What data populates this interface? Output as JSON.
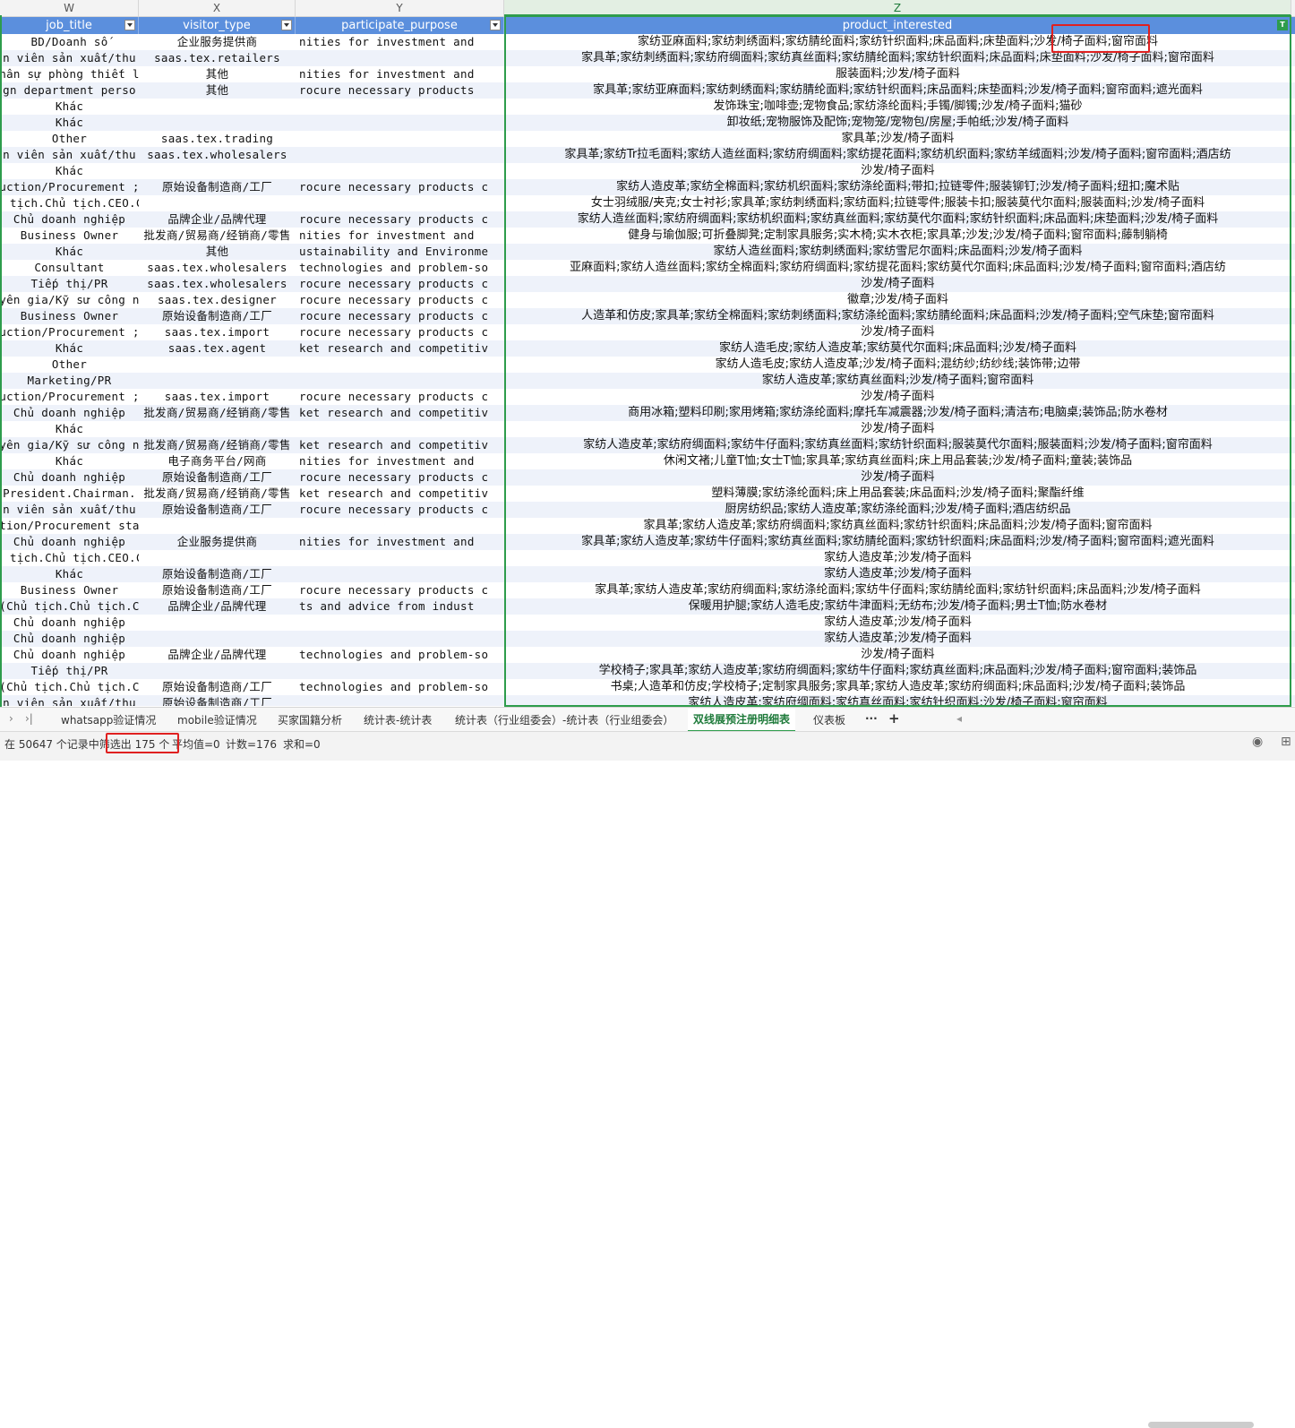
{
  "columns": [
    {
      "letter": "W",
      "field": "job_title"
    },
    {
      "letter": "X",
      "field": "visitor_type"
    },
    {
      "letter": "Y",
      "field": "participate_purpose"
    },
    {
      "letter": "Z",
      "field": "product_interested"
    }
  ],
  "rows": [
    [
      "BD/Doanh số",
      "企业服务提供商",
      "nities for investment and",
      "家纺亚麻面料;家纺刺绣面料;家纺腈纶面料;家纺针织面料;床品面料;床垫面料;沙发/椅子面料;窗帘面料"
    ],
    [
      "n viên sản xuất/thu",
      "saas.tex.retailers",
      "",
      "家具革;家纺刺绣面料;家纺府绸面料;家纺真丝面料;家纺腈纶面料;家纺针织面料;床品面料;床垫面料;沙发/椅子面料;窗帘面料"
    ],
    [
      "hân sự phòng thiết l",
      "其他",
      "nities for investment and",
      "服装面料;沙发/椅子面料"
    ],
    [
      "gn department perso",
      "其他",
      "rocure necessary products",
      "家具革;家纺亚麻面料;家纺刺绣面料;家纺腈纶面料;家纺针织面料;床品面料;床垫面料;沙发/椅子面料;窗帘面料;遮光面料"
    ],
    [
      "Khác",
      "",
      "",
      "发饰珠宝;咖啡壶;宠物食品;家纺涤纶面料;手镯/脚镯;沙发/椅子面料;猫砂"
    ],
    [
      "Khác",
      "",
      "",
      "卸妆纸;宠物服饰及配饰;宠物笼/宠物包/房屋;手帕纸;沙发/椅子面料"
    ],
    [
      "Other",
      "saas.tex.trading",
      "",
      "家具革;沙发/椅子面料"
    ],
    [
      "n viên sản xuất/thu",
      "saas.tex.wholesalers",
      "",
      "家具革;家纺Tr拉毛面料;家纺人造丝面料;家纺府绸面料;家纺提花面料;家纺机织面料;家纺羊绒面料;沙发/椅子面料;窗帘面料;酒店纺"
    ],
    [
      "Khác",
      "",
      "",
      "沙发/椅子面料"
    ],
    [
      "uction/Procurement ;",
      "原始设备制造商/工厂",
      "rocure necessary products c",
      "家纺人造皮革;家纺全棉面料;家纺机织面料;家纺涤纶面料;带扣;拉链零件;服装铆钉;沙发/椅子面料;纽扣;魔术贴"
    ],
    [
      "(Chủ tịch.Chủ tịch.CEO.COO)",
      "",
      "",
      "女士羽绒服/夹克;女士衬衫;家具革;家纺刺绣面料;家纺面料;拉链零件;服装卡扣;服装莫代尔面料;服装面料;沙发/椅子面料"
    ],
    [
      "Chủ doanh nghiệp",
      "品牌企业/品牌代理",
      "rocure necessary products c",
      "家纺人造丝面料;家纺府绸面料;家纺机织面料;家纺真丝面料;家纺莫代尔面料;家纺针织面料;床品面料;床垫面料;沙发/椅子面料"
    ],
    [
      "Business Owner",
      "批发商/贸易商/经销商/零售",
      "nities for investment and",
      "健身与瑜伽服;可折叠脚凳;定制家具服务;实木椅;实木衣柜;家具革;沙发;沙发/椅子面料;窗帘面料;藤制躺椅"
    ],
    [
      "Khác",
      "其他",
      "ustainability and Environme",
      "家纺人造丝面料;家纺刺绣面料;家纺雪尼尔面料;床品面料;沙发/椅子面料"
    ],
    [
      "Consultant",
      "saas.tex.wholesalers",
      "technologies and problem-so",
      "亚麻面料;家纺人造丝面料;家纺全棉面料;家纺府绸面料;家纺提花面料;家纺莫代尔面料;床品面料;沙发/椅子面料;窗帘面料;酒店纺"
    ],
    [
      "Tiếp thị/PR",
      "saas.tex.wholesalers",
      "rocure necessary products c",
      "沙发/椅子面料"
    ],
    [
      "yên gia/Kỹ sư công n",
      "saas.tex.designer",
      "rocure necessary products c",
      "徽章;沙发/椅子面料"
    ],
    [
      "Business Owner",
      "原始设备制造商/工厂",
      "rocure necessary products c",
      "人造革和仿皮;家具革;家纺全棉面料;家纺刺绣面料;家纺涤纶面料;家纺腈纶面料;床品面料;沙发/椅子面料;空气床垫;窗帘面料"
    ],
    [
      "uction/Procurement ;",
      "saas.tex.import",
      "rocure necessary products c",
      "沙发/椅子面料"
    ],
    [
      "Khác",
      "saas.tex.agent",
      "ket research and competitiv",
      "家纺人造毛皮;家纺人造皮革;家纺莫代尔面料;床品面料;沙发/椅子面料"
    ],
    [
      "Other",
      "",
      "",
      "家纺人造毛皮;家纺人造皮革;沙发/椅子面料;混纺纱;纺纱线;装饰带;边带"
    ],
    [
      "Marketing/PR",
      "",
      "",
      "家纺人造皮革;家纺真丝面料;沙发/椅子面料;窗帘面料"
    ],
    [
      "uction/Procurement ;",
      "saas.tex.import",
      "rocure necessary products c",
      "沙发/椅子面料"
    ],
    [
      "Chủ doanh nghiệp",
      "批发商/贸易商/经销商/零售",
      "ket research and competitiv",
      "商用冰箱;塑料印刷;家用烤箱;家纺涤纶面料;摩托车减震器;沙发/椅子面料;清洁布;电脑桌;装饰品;防水卷材"
    ],
    [
      "Khác",
      "",
      "",
      "沙发/椅子面料"
    ],
    [
      "yên gia/Kỹ sư công n",
      "批发商/贸易商/经销商/零售",
      "ket research and competitiv",
      "家纺人造皮革;家纺府绸面料;家纺牛仔面料;家纺真丝面料;家纺针织面料;服装莫代尔面料;服装面料;沙发/椅子面料;窗帘面料"
    ],
    [
      "Khác",
      "电子商务平台/网商",
      "nities for investment and",
      "休闲文褚;儿童T恤;女士T恤;家具革;家纺真丝面料;床上用品套装;沙发/椅子面料;童装;装饰品"
    ],
    [
      "Chủ doanh nghiệp",
      "原始设备制造商/工厂",
      "rocure necessary products c",
      "沙发/椅子面料"
    ],
    [
      "President.Chairman.",
      "批发商/贸易商/经销商/零售",
      "ket research and competitiv",
      "塑料薄膜;家纺涤纶面料;床上用品套装;床品面料;沙发/椅子面料;聚酯纤维"
    ],
    [
      "n viên sản xuất/thu",
      "原始设备制造商/工厂",
      "rocure necessary products c",
      "厨房纺织品;家纺人造皮革;家纺涤纶面料;沙发/椅子面料;酒店纺织品"
    ],
    [
      "uction/Procurement staff",
      "",
      "",
      "家具革;家纺人造皮革;家纺府绸面料;家纺真丝面料;家纺针织面料;床品面料;沙发/椅子面料;窗帘面料"
    ],
    [
      "Chủ doanh nghiệp",
      "企业服务提供商",
      "nities for investment and",
      "家具革;家纺人造皮革;家纺牛仔面料;家纺真丝面料;家纺腈纶面料;家纺针织面料;床品面料;沙发/椅子面料;窗帘面料;遮光面料"
    ],
    [
      "(Chủ tịch.Chủ tịch.CEO.COO)",
      "",
      "",
      "家纺人造皮革;沙发/椅子面料"
    ],
    [
      "Khác",
      "原始设备制造商/工厂",
      "",
      "家纺人造皮革;沙发/椅子面料"
    ],
    [
      "Business Owner",
      "原始设备制造商/工厂",
      "rocure necessary products c",
      "家具革;家纺人造皮革;家纺府绸面料;家纺涤纶面料;家纺牛仔面料;家纺腈纶面料;家纺针织面料;床品面料;沙发/椅子面料"
    ],
    [
      "(Chủ tịch.Chủ tịch.C",
      "品牌企业/品牌代理",
      "ts and advice from indust",
      "保暖用护腿;家纺人造毛皮;家纺牛津面料;无纺布;沙发/椅子面料;男士T恤;防水卷材"
    ],
    [
      "Chủ doanh nghiệp",
      "",
      "",
      "家纺人造皮革;沙发/椅子面料"
    ],
    [
      "Chủ doanh nghiệp",
      "",
      "",
      "家纺人造皮革;沙发/椅子面料"
    ],
    [
      "Chủ doanh nghiệp",
      "品牌企业/品牌代理",
      "technologies and problem-so",
      "沙发/椅子面料"
    ],
    [
      "Tiếp thị/PR",
      "",
      "",
      "学校椅子;家具革;家纺人造皮革;家纺府绸面料;家纺牛仔面料;家纺真丝面料;床品面料;沙发/椅子面料;窗帘面料;装饰品"
    ],
    [
      "(Chủ tịch.Chủ tịch.C",
      "原始设备制造商/工厂",
      "technologies and problem-so",
      "书桌;人造革和仿皮;学校椅子;定制家具服务;家具革;家纺人造皮革;家纺府绸面料;床品面料;沙发/椅子面料;装饰品"
    ],
    [
      "n viên sản xuất/thu",
      "原始设备制造商/工厂",
      "",
      "家纺人造皮革;家纺府绸面料;家纺真丝面料;家纺针织面料;沙发/椅子面料;窗帘面料"
    ]
  ],
  "sheet_tabs": [
    "whatsapp验证情况",
    "mobile验证情况",
    "买家国籍分析",
    "统计表-统计表",
    "统计表（行业组委会）-统计表（行业组委会）",
    "双线展预注册明细表",
    "仪表板"
  ],
  "active_tab": "双线展预注册明细表",
  "status": {
    "filter_text": "在 50647 个记录中筛选出 175 个",
    "average": "平均值=0",
    "count": "计数=176",
    "sum": "求和=0"
  },
  "colors": {
    "header_bg": "#5b8fdd",
    "selection": "#2e9c4c",
    "highlight": "#e02020"
  }
}
